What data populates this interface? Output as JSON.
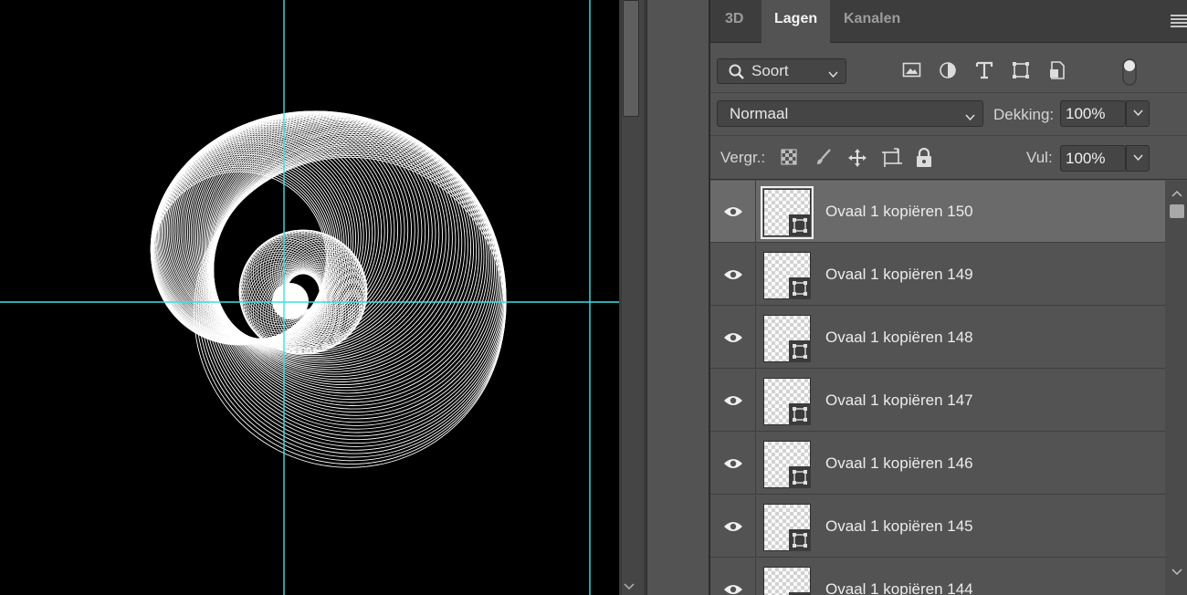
{
  "canvas": {
    "background": "#000000",
    "guide_color": "#3ce0e6",
    "artwork": "spirograph-ovals"
  },
  "panel": {
    "tabs": [
      {
        "label": "3D",
        "active": false
      },
      {
        "label": "Lagen",
        "active": true
      },
      {
        "label": "Kanalen",
        "active": false
      }
    ],
    "menu_icon": "panel-menu-icon",
    "filter": {
      "kind_label": "Soort",
      "icons": [
        "image-filter-icon",
        "adjustment-filter-icon",
        "type-filter-icon",
        "shape-filter-icon",
        "smart-object-filter-icon"
      ]
    },
    "blend_mode": "Normaal",
    "opacity_label": "Dekking:",
    "opacity_value": "100%",
    "lock_label": "Vergr.:",
    "lock_icons": [
      "lock-transparency-icon",
      "lock-image-icon",
      "lock-position-icon",
      "lock-artboard-icon",
      "lock-all-icon"
    ],
    "fill_label": "Vul:",
    "fill_value": "100%"
  },
  "layers": [
    {
      "name": "Ovaal 1 kopiëren 150",
      "selected": true,
      "visible": true
    },
    {
      "name": "Ovaal 1 kopiëren 149",
      "selected": false,
      "visible": true
    },
    {
      "name": "Ovaal 1 kopiëren 148",
      "selected": false,
      "visible": true
    },
    {
      "name": "Ovaal 1 kopiëren 147",
      "selected": false,
      "visible": true
    },
    {
      "name": "Ovaal 1 kopiëren 146",
      "selected": false,
      "visible": true
    },
    {
      "name": "Ovaal 1 kopiëren 145",
      "selected": false,
      "visible": true
    },
    {
      "name": "Ovaal 1 kopiëren 144",
      "selected": false,
      "visible": true
    }
  ]
}
